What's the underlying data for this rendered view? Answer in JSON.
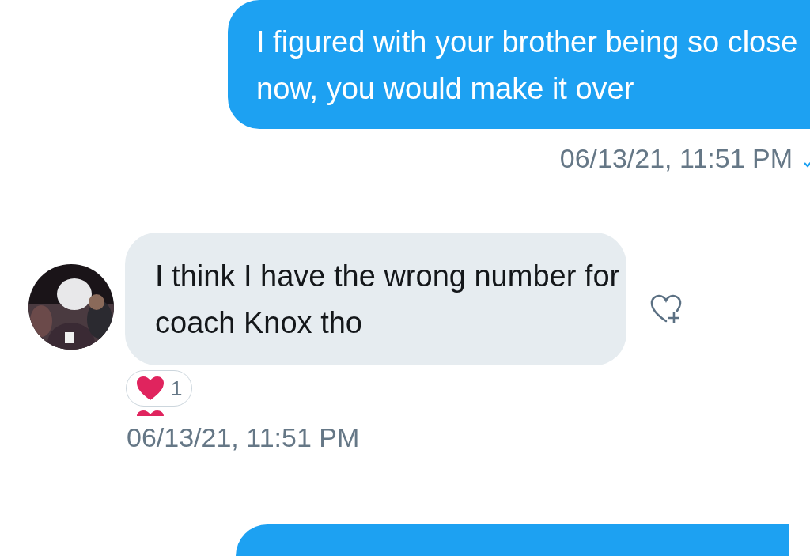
{
  "messages": [
    {
      "kind": "sent",
      "text": "I figured with your brother being so close now, you would make it over",
      "time": "06/13/21, 11:51 PM",
      "read": true
    },
    {
      "kind": "received",
      "text": "I think I have the wrong number for coach Knox tho",
      "time": "06/13/21, 11:51 PM",
      "reactions": [
        {
          "count": "1"
        }
      ]
    },
    {
      "kind": "sent"
    }
  ]
}
